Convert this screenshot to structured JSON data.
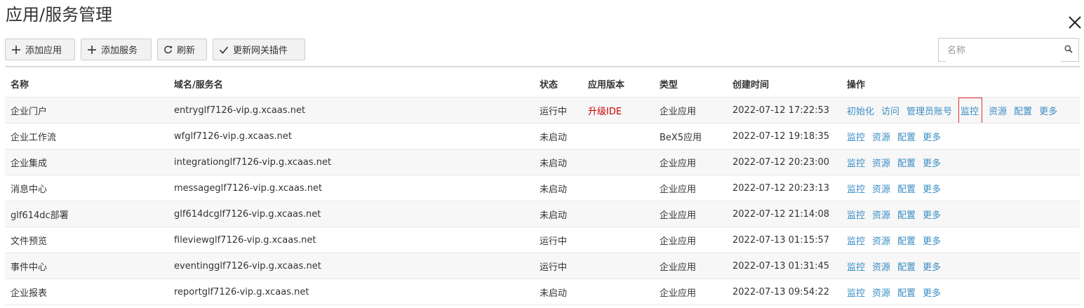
{
  "header": {
    "title": "应用/服务管理"
  },
  "toolbar": {
    "add_app": "添加应用",
    "add_service": "添加服务",
    "refresh": "刷新",
    "update_plugin": "更新网关插件"
  },
  "search": {
    "placeholder": "名称"
  },
  "table": {
    "columns": [
      "名称",
      "域名/服务名",
      "状态",
      "应用版本",
      "类型",
      "创建时间",
      "操作"
    ],
    "rows": [
      {
        "name": "企业门户",
        "domain": "entryglf7126-vip.g.xcaas.net",
        "status": "运行中",
        "version": "升级IDE",
        "type": "企业应用",
        "created": "2022-07-12 17:22:53",
        "actions": [
          "初始化",
          "访问",
          "管理员账号",
          "监控",
          "资源",
          "配置",
          "更多"
        ]
      },
      {
        "name": "企业工作流",
        "domain": "wfglf7126-vip.g.xcaas.net",
        "status": "未启动",
        "version": "",
        "type": "BeX5应用",
        "created": "2022-07-12 19:18:35",
        "actions": [
          "监控",
          "资源",
          "配置",
          "更多"
        ]
      },
      {
        "name": "企业集成",
        "domain": "integrationglf7126-vip.g.xcaas.net",
        "status": "未启动",
        "version": "",
        "type": "企业应用",
        "created": "2022-07-12 20:23:00",
        "actions": [
          "监控",
          "资源",
          "配置",
          "更多"
        ]
      },
      {
        "name": "消息中心",
        "domain": "messageglf7126-vip.g.xcaas.net",
        "status": "未启动",
        "version": "",
        "type": "企业应用",
        "created": "2022-07-12 20:23:13",
        "actions": [
          "监控",
          "资源",
          "配置",
          "更多"
        ]
      },
      {
        "name": "glf614dc部署",
        "domain": "glf614dcglf7126-vip.g.xcaas.net",
        "status": "未启动",
        "version": "",
        "type": "企业应用",
        "created": "2022-07-12 21:14:08",
        "actions": [
          "监控",
          "资源",
          "配置",
          "更多"
        ]
      },
      {
        "name": "文件预览",
        "domain": "fileviewglf7126-vip.g.xcaas.net",
        "status": "运行中",
        "version": "",
        "type": "企业应用",
        "created": "2022-07-13 01:15:57",
        "actions": [
          "监控",
          "资源",
          "配置",
          "更多"
        ]
      },
      {
        "name": "事件中心",
        "domain": "eventingglf7126-vip.g.xcaas.net",
        "status": "运行中",
        "version": "",
        "type": "企业应用",
        "created": "2022-07-13 01:31:45",
        "actions": [
          "监控",
          "资源",
          "配置",
          "更多"
        ]
      },
      {
        "name": "企业报表",
        "domain": "reportglf7126-vip.g.xcaas.net",
        "status": "未启动",
        "version": "",
        "type": "企业应用",
        "created": "2022-07-13 09:54:22",
        "actions": [
          "监控",
          "资源",
          "配置",
          "更多"
        ]
      }
    ]
  },
  "colors": {
    "link": "#3a8dc4",
    "warning": "#cc0000",
    "highlight": "#e03030"
  },
  "icons": {
    "close": "close-icon",
    "search": "search-icon",
    "add": "plus-icon",
    "refresh": "refresh-icon",
    "update": "check-icon"
  }
}
